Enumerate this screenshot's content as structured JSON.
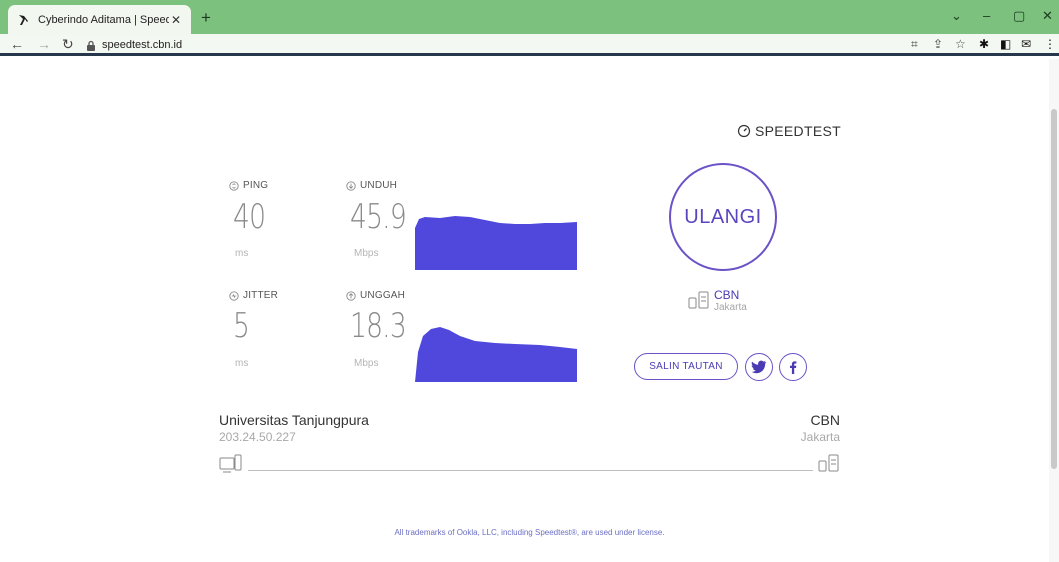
{
  "browser": {
    "tab_title": "Cyberindo Aditama | Speedtest",
    "url": "speedtest.cbn.id"
  },
  "brand": {
    "label": "SPEEDTEST"
  },
  "ping": {
    "label": "PING",
    "value": "40",
    "unit": "ms"
  },
  "jitter": {
    "label": "JITTER",
    "value": "5",
    "unit": "ms"
  },
  "download": {
    "label": "UNDUH",
    "value": "45.9",
    "unit": "Mbps"
  },
  "upload": {
    "label": "UNGGAH",
    "value": "18.3",
    "unit": "Mbps"
  },
  "again_button": {
    "label": "ULANGI"
  },
  "selected_server": {
    "name": "CBN",
    "location": "Jakarta"
  },
  "share": {
    "copy_link_label": "SALIN TAUTAN"
  },
  "connection": {
    "isp_name": "Universitas Tanjungpura",
    "isp_ip": "203.24.50.227",
    "server_name": "CBN",
    "server_location": "Jakarta"
  },
  "footer": {
    "note": "All trademarks of Ookla, LLC, including Speedtest®, are used under license."
  },
  "colors": {
    "accent": "#5b45bf",
    "graph_fill": "#5048dc",
    "tab_bar": "#7cc17e"
  }
}
